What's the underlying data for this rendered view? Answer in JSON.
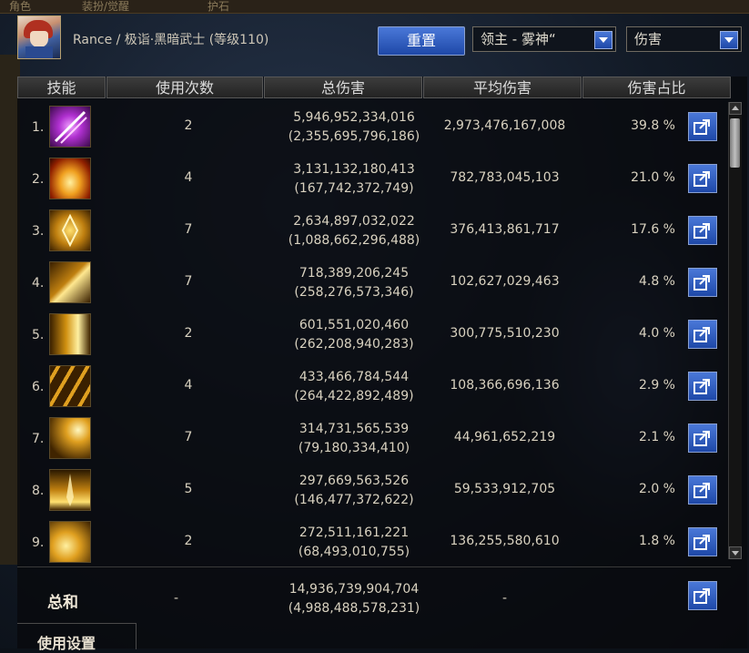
{
  "header": {
    "character": "Rance / 极诣·黑暗武士 (等级110)",
    "reset_label": "重置",
    "target_select": "领主 - 雾神“",
    "mode_select": "伤害"
  },
  "columns": [
    "技能",
    "使用次数",
    "总伤害",
    "平均伤害",
    "伤害占比"
  ],
  "rows": [
    {
      "index": "1.",
      "icon": "purple-slash-skill-icon",
      "uses": "2",
      "total": "5,946,952,334,016",
      "total_sub": "(2,355,695,796,186)",
      "avg": "2,973,476,167,008",
      "pct": "39.8 %"
    },
    {
      "index": "2.",
      "icon": "fire-burst-skill-icon",
      "uses": "4",
      "total": "3,131,132,180,413",
      "total_sub": "(167,742,372,749)",
      "avg": "782,783,045,103",
      "pct": "21.0 %"
    },
    {
      "index": "3.",
      "icon": "golden-lotus-skill-icon",
      "uses": "7",
      "total": "2,634,897,032,022",
      "total_sub": "(1,088,662,296,488)",
      "avg": "376,413,861,717",
      "pct": "17.6 %"
    },
    {
      "index": "4.",
      "icon": "golden-slash-skill-icon",
      "uses": "7",
      "total": "718,389,206,245",
      "total_sub": "(258,276,573,346)",
      "avg": "102,627,029,463",
      "pct": "4.8 %"
    },
    {
      "index": "5.",
      "icon": "golden-dash-skill-icon",
      "uses": "2",
      "total": "601,551,020,460",
      "total_sub": "(262,208,940,283)",
      "avg": "300,775,510,230",
      "pct": "4.0 %"
    },
    {
      "index": "6.",
      "icon": "golden-claw-skill-icon",
      "uses": "4",
      "total": "433,466,784,544",
      "total_sub": "(264,422,892,489)",
      "avg": "108,366,696,136",
      "pct": "2.9 %"
    },
    {
      "index": "7.",
      "icon": "golden-strike-skill-icon",
      "uses": "7",
      "total": "314,731,565,539",
      "total_sub": "(79,180,334,410)",
      "avg": "44,961,652,219",
      "pct": "2.1 %"
    },
    {
      "index": "8.",
      "icon": "golden-sword-skill-icon",
      "uses": "5",
      "total": "297,669,563,526",
      "total_sub": "(146,477,372,622)",
      "avg": "59,533,912,705",
      "pct": "2.0 %"
    },
    {
      "index": "9.",
      "icon": "golden-wing-skill-icon",
      "uses": "2",
      "total": "272,511,161,221",
      "total_sub": "(68,493,010,755)",
      "avg": "136,255,580,610",
      "pct": "1.8 %"
    }
  ],
  "summary": {
    "label": "总和",
    "uses": "-",
    "total": "14,936,739,904,704",
    "total_sub": "(4,988,488,578,231)",
    "avg": "-"
  },
  "settings_label": "使用设置",
  "background_tabs": [
    "角色",
    "装扮/觉醒",
    "护石"
  ]
}
